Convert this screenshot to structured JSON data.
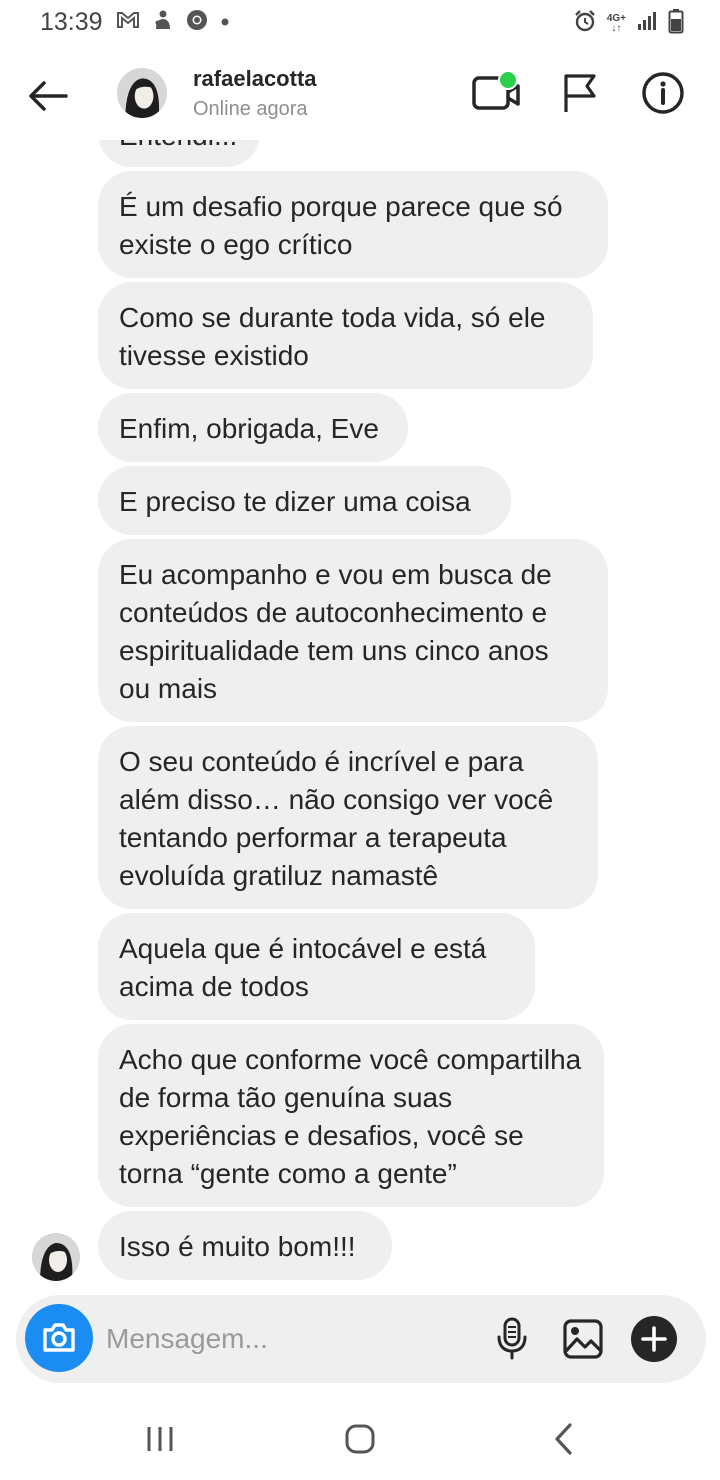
{
  "status_bar": {
    "time": "13:39",
    "network": "4G+",
    "left_icons": [
      "gmail-icon",
      "app-notification-icon",
      "chrome-icon",
      "dot-icon"
    ],
    "right_icons": [
      "alarm-icon",
      "network-4g-icon",
      "signal-icon",
      "battery-icon"
    ]
  },
  "header": {
    "username": "rafaelacotta",
    "status": "Online agora",
    "online_color": "#2ccf4a"
  },
  "messages": [
    {
      "text": "Entendi..."
    },
    {
      "text": "É um desafio porque parece que só existe o ego crítico"
    },
    {
      "text": "Como se durante toda vida, só ele tivesse existido"
    },
    {
      "text": "Enfim, obrigada, Eve"
    },
    {
      "text": "E preciso te dizer uma coisa"
    },
    {
      "text": "Eu acompanho e vou em busca de conteúdos de autoconhecimento e espiritualidade tem uns cinco anos ou mais"
    },
    {
      "text": "O seu conteúdo é incrível e para além disso… não consigo ver você tentando performar a terapeuta evoluída gratiluz namastê"
    },
    {
      "text": "Aquela que é intocável e está acima de todos"
    },
    {
      "text": "Acho que conforme você compartilha de forma tão genuína suas experiências e desafios, você se torna “gente como a gente”"
    },
    {
      "text": "Isso é muito bom!!!"
    }
  ],
  "composer": {
    "placeholder": "Mensagem...",
    "camera_color": "#1a8cf2"
  }
}
